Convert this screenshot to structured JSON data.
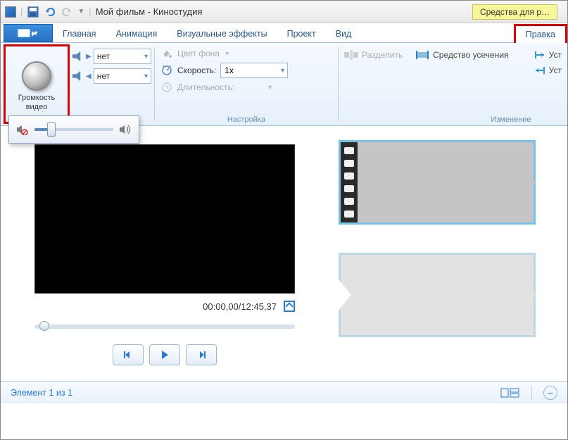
{
  "titlebar": {
    "title": "Мой фильм - Киностудия",
    "context_tab": "Средства для р…"
  },
  "tabs": {
    "home": "Главная",
    "animation": "Анимация",
    "visual_effects": "Визуальные эффекты",
    "project": "Проект",
    "view": "Вид",
    "edit": "Правка"
  },
  "ribbon": {
    "volume_label": "Громкость\nвидео",
    "fade_in_value": "нет",
    "fade_out_value": "нет",
    "bg_color_label": "Цвет фона",
    "speed_label": "Скорость:",
    "speed_value": "1x",
    "duration_label": "Длительность:",
    "settings_group_label": "Настройка",
    "split_label": "Разделить",
    "trim_tool_label": "Средство усечения",
    "set1": "Уст",
    "set2": "Уст",
    "edit_group_label": "Изменение"
  },
  "preview": {
    "timecode": "00:00,00/12:45,37"
  },
  "status": {
    "element_text": "Элемент 1 из 1"
  }
}
